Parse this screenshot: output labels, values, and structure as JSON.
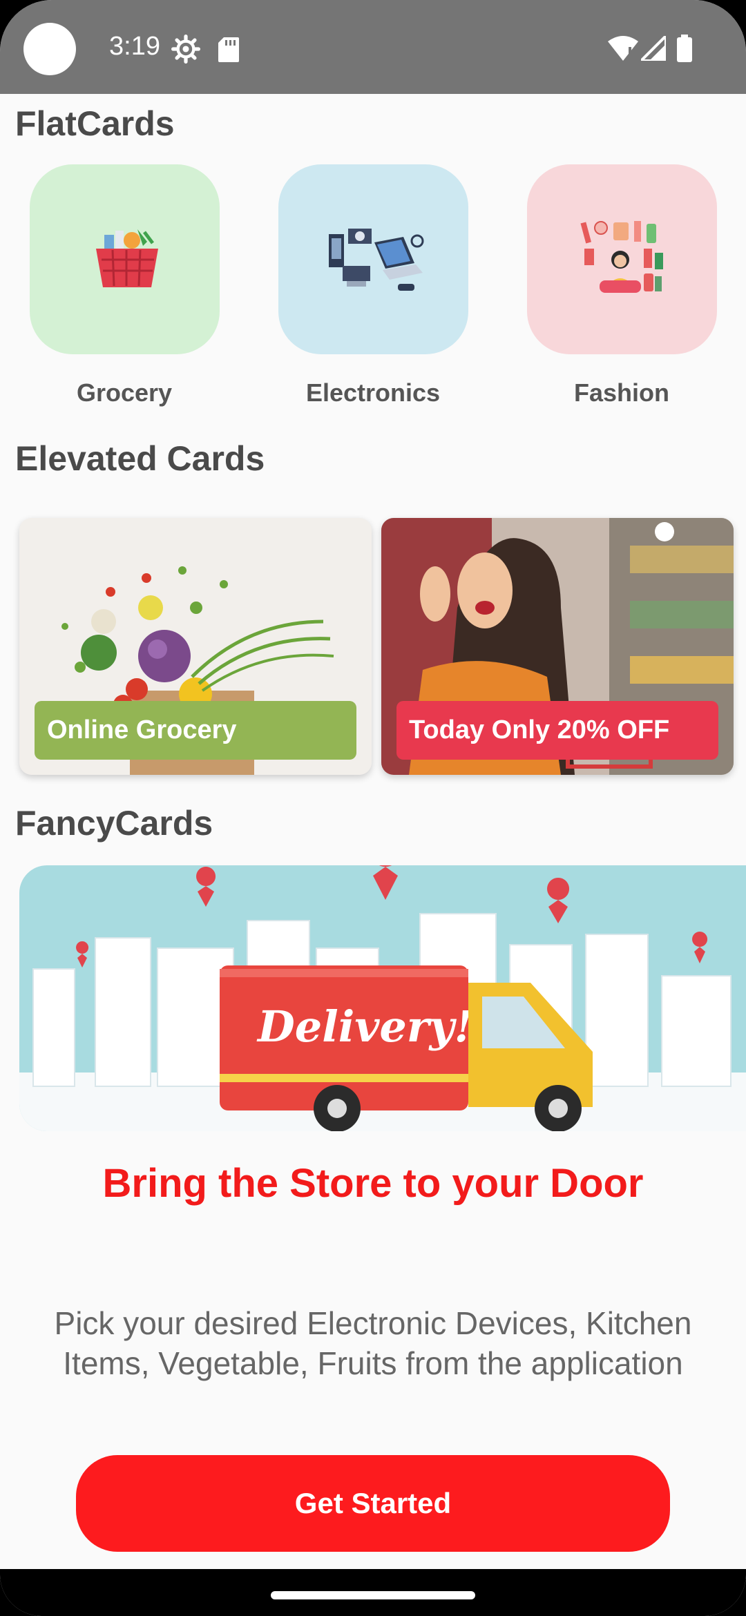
{
  "status_bar": {
    "time": "3:19",
    "icons": [
      "settings-gear-icon",
      "sd-card-icon",
      "wifi-icon",
      "cell-signal-icon",
      "battery-icon"
    ]
  },
  "sections": {
    "flat_title": "FlatCards",
    "elevated_title": "Elevated Cards",
    "fancy_title": "FancyCards"
  },
  "flat_cards": [
    {
      "label": "Grocery",
      "bg": "#d4f1d4",
      "icon": "grocery-basket-icon"
    },
    {
      "label": "Electronics",
      "bg": "#cde8f1",
      "icon": "electronics-icon"
    },
    {
      "label": "Fashion",
      "bg": "#f8d7da",
      "icon": "fashion-icon"
    }
  ],
  "elevated_cards": [
    {
      "label": "Online Grocery",
      "badge_color": "#93b554",
      "image": "vegetables-photo"
    },
    {
      "label": "Today Only 20% OFF",
      "badge_color": "#e8394e",
      "image": "shopping-woman-photo"
    }
  ],
  "fancy_card": {
    "image": "delivery-truck-illustration",
    "truck_text": "Delivery!",
    "title": "Bring the Store to your Door",
    "description": "Pick your desired Electronic Devices, Kitchen Items, Vegetable, Fruits from the application",
    "button_label": "Get Started"
  },
  "colors": {
    "accent": "#fd1b1e",
    "status_bar": "#757575",
    "background": "#fafafa"
  }
}
